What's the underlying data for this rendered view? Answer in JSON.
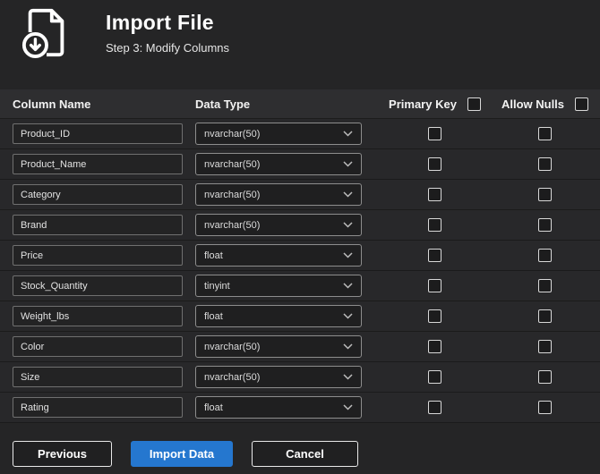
{
  "header": {
    "title": "Import File",
    "subtitle": "Step 3: Modify Columns",
    "icon": "import-file-icon"
  },
  "table": {
    "headers": {
      "column_name": "Column Name",
      "data_type": "Data Type",
      "primary_key": "Primary Key",
      "allow_nulls": "Allow Nulls"
    },
    "header_checkboxes": {
      "primary_key_checked": false,
      "allow_nulls_checked": false
    },
    "rows": [
      {
        "name": "Product_ID",
        "type": "nvarchar(50)",
        "primary_key": false,
        "allow_nulls": false
      },
      {
        "name": "Product_Name",
        "type": "nvarchar(50)",
        "primary_key": false,
        "allow_nulls": false
      },
      {
        "name": "Category",
        "type": "nvarchar(50)",
        "primary_key": false,
        "allow_nulls": false
      },
      {
        "name": "Brand",
        "type": "nvarchar(50)",
        "primary_key": false,
        "allow_nulls": false
      },
      {
        "name": "Price",
        "type": "float",
        "primary_key": false,
        "allow_nulls": false
      },
      {
        "name": "Stock_Quantity",
        "type": "tinyint",
        "primary_key": false,
        "allow_nulls": false
      },
      {
        "name": "Weight_lbs",
        "type": "float",
        "primary_key": false,
        "allow_nulls": false
      },
      {
        "name": "Color",
        "type": "nvarchar(50)",
        "primary_key": false,
        "allow_nulls": false
      },
      {
        "name": "Size",
        "type": "nvarchar(50)",
        "primary_key": false,
        "allow_nulls": false
      },
      {
        "name": "Rating",
        "type": "float",
        "primary_key": false,
        "allow_nulls": false
      }
    ]
  },
  "footer": {
    "previous_label": "Previous",
    "import_label": "Import Data",
    "cancel_label": "Cancel"
  },
  "colors": {
    "accent": "#2577cf",
    "background": "#252526",
    "header_row": "#2e2e30"
  }
}
